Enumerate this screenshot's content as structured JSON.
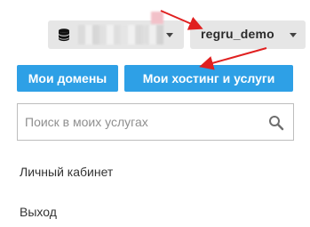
{
  "topbar": {
    "balance_icon": "coins-icon",
    "user_label": "regru_demo"
  },
  "nav": {
    "domains_label": "Мои домены",
    "hosting_label": "Мои хостинг и услуги"
  },
  "search": {
    "placeholder": "Поиск в моих услугах",
    "value": "",
    "icon": "search-icon"
  },
  "menu": {
    "cabinet_label": "Личный кабинет",
    "logout_label": "Выход"
  },
  "colors": {
    "nav_button": "#2ea0e6",
    "dropdown_bg": "#e6e6e6",
    "annotation_arrow": "#e02020"
  }
}
